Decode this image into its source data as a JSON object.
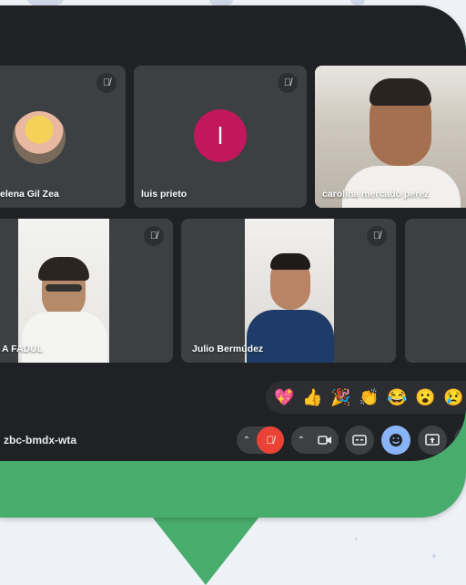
{
  "participants": [
    {
      "name": "elena Gil Zea"
    },
    {
      "name": "luis prieto",
      "initial": "l"
    },
    {
      "name": "carolina mercado perez"
    },
    {
      "name": "A FADUL"
    },
    {
      "name": "Julio Bermúdez"
    }
  ],
  "reactions": [
    "💖",
    "👍",
    "🎉",
    "👏",
    "😂",
    "😮",
    "😢"
  ],
  "meeting_code": "zbc-bmdx-wta",
  "colors": {
    "accent": "#8ab4f8",
    "mic_off": "#ea4335",
    "bubble": "#48ad6c",
    "avatar": "#c2185b"
  },
  "icons": [
    "mic-off-icon",
    "camera-icon",
    "captions-icon",
    "emoji-icon",
    "present-icon",
    "raise-hand-icon",
    "chevron-up-icon"
  ]
}
